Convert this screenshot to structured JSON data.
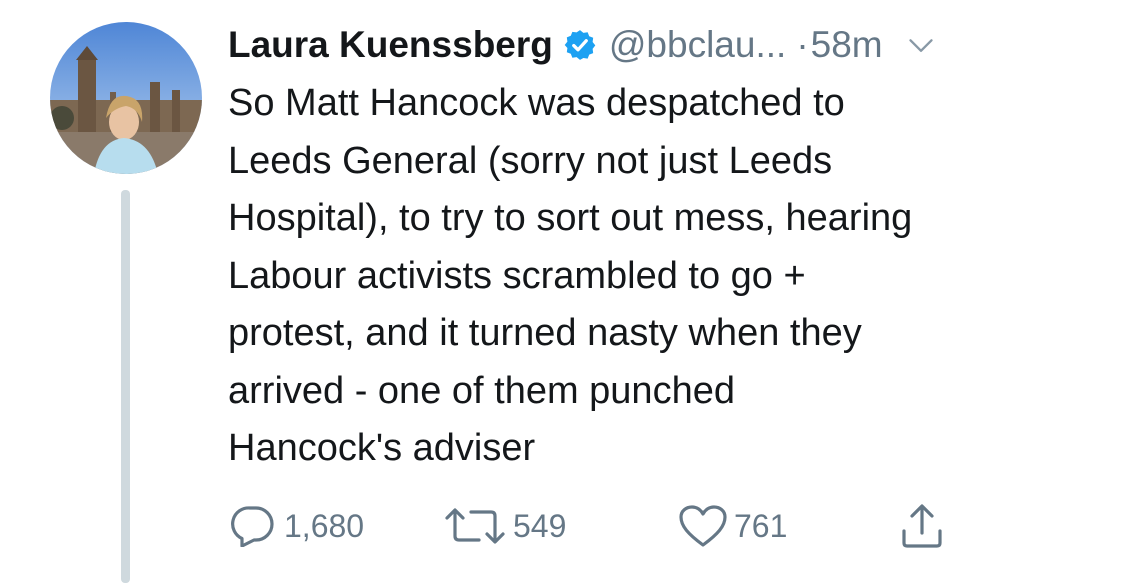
{
  "tweet": {
    "author_name": "Laura Kuenssberg",
    "handle": "@bbclau...",
    "separator": "·",
    "time": "58m",
    "lines": [
      "So Matt Hancock was despatched to",
      "Leeds General (sorry not just Leeds",
      "Hospital), to try to sort out mess, hearing",
      "Labour activists scrambled to go +",
      "protest, and it turned nasty when they",
      "arrived - one of them punched",
      "Hancock's adviser"
    ],
    "reply_count": "1,680",
    "retweet_count": "549",
    "like_count": "761"
  },
  "icons": {
    "verified": "verified-badge-icon",
    "caret": "chevron-down-icon",
    "reply": "reply-icon",
    "retweet": "retweet-icon",
    "like": "heart-icon",
    "share": "share-icon"
  },
  "colors": {
    "text": "#14171a",
    "secondary": "#657786",
    "verified": "#1da1f2",
    "thread_line": "#cfd9de"
  }
}
